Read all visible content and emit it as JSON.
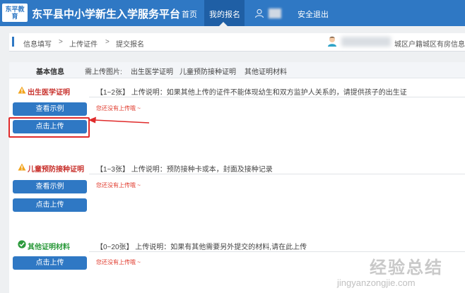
{
  "header": {
    "logo_text": "东平教育",
    "site_title": "东平县中小学新生入学服务平台",
    "nav": {
      "home": "首页",
      "my_application": "我的报名",
      "logout": "安全退出"
    }
  },
  "breadcrumb": {
    "step1": "信息填写",
    "step2": "上传证件",
    "step3": "提交报名",
    "separator": ">",
    "right_text": "城区户籍城区有房信息采集"
  },
  "panel": {
    "header_title": "基本信息",
    "required_label": "需上传图片:",
    "required_items": [
      "出生医学证明",
      "儿童预防接种证明",
      "其他证明材料"
    ],
    "sections": [
      {
        "label": "出生医学证明",
        "status_icon": "warning-icon",
        "description": "【1~2张】 上传说明：如果其他上传的证件不能体现幼生和双方监护人关系的，请提供孩子的出生证",
        "example_button": "查看示例",
        "upload_button": "点击上传",
        "empty_note": "您还没有上传哦 ~"
      },
      {
        "label": "儿童预防接种证明",
        "status_icon": "warning-icon",
        "description": "【1~3张】 上传说明：预防接种卡或本，封面及接种记录",
        "example_button": "查看示例",
        "upload_button": "点击上传",
        "empty_note": "您还没有上传哦 ~"
      },
      {
        "label": "其他证明材料",
        "status_icon": "check-icon",
        "description": "【0~20张】 上传说明：如果有其他需要另外提交的材料,请在此上传",
        "upload_button": "点击上传",
        "empty_note": "您还没有上传哦 ~"
      }
    ]
  },
  "watermark": {
    "cn": "经验总结",
    "en": "jingyanzongjie.com"
  },
  "colors": {
    "brand_blue": "#2f78c4",
    "warning_red": "#c8302b",
    "ok_green": "#2c9a3c",
    "highlight_red": "#e02b2b"
  }
}
